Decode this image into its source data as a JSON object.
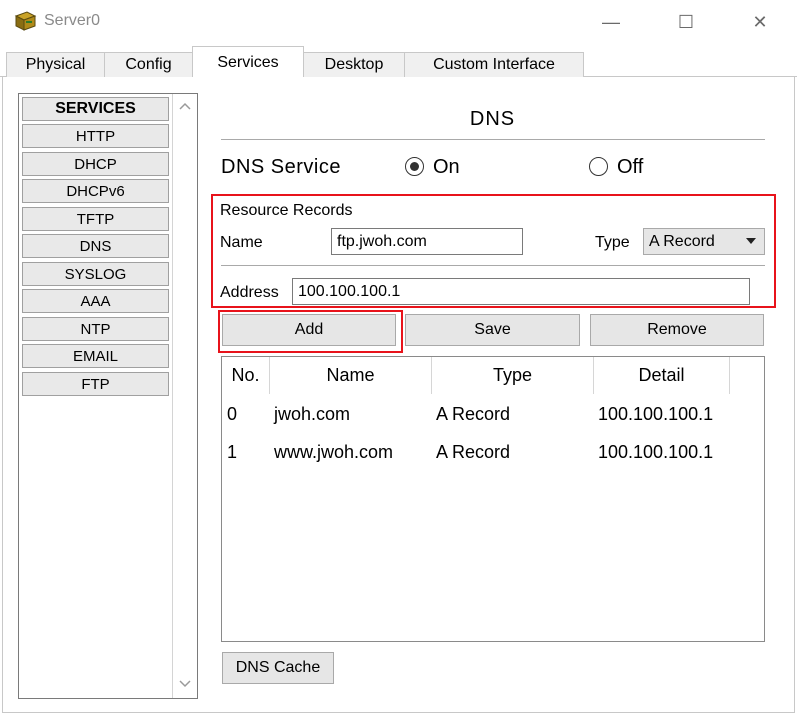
{
  "window": {
    "title": "Server0",
    "minimize_glyph": "—",
    "maximize_glyph": "☐",
    "close_glyph": "✕"
  },
  "tabs": [
    {
      "label": "Physical"
    },
    {
      "label": "Config"
    },
    {
      "label": "Services"
    },
    {
      "label": "Desktop"
    },
    {
      "label": "Custom Interface"
    }
  ],
  "active_tab": "Services",
  "services": {
    "header": "SERVICES",
    "items": [
      "HTTP",
      "DHCP",
      "DHCPv6",
      "TFTP",
      "DNS",
      "SYSLOG",
      "AAA",
      "NTP",
      "EMAIL",
      "FTP"
    ]
  },
  "dns": {
    "title": "DNS",
    "service_label": "DNS Service",
    "on_label": "On",
    "off_label": "Off",
    "service_state": "On",
    "resource_records_label": "Resource Records",
    "name_label": "Name",
    "name_value": "ftp.jwoh.com",
    "type_label": "Type",
    "type_value": "A Record",
    "address_label": "Address",
    "address_value": "100.100.100.1",
    "add_label": "Add",
    "save_label": "Save",
    "remove_label": "Remove",
    "table": {
      "headers": [
        "No.",
        "Name",
        "Type",
        "Detail"
      ],
      "rows": [
        {
          "no": "0",
          "name": "jwoh.com",
          "type": "A Record",
          "detail": "100.100.100.1"
        },
        {
          "no": "1",
          "name": "www.jwoh.com",
          "type": "A Record",
          "detail": "100.100.100.1"
        }
      ]
    },
    "cache_label": "DNS Cache"
  },
  "colors": {
    "highlight": "#e8131b",
    "button_bg": "#e6e6e6"
  }
}
